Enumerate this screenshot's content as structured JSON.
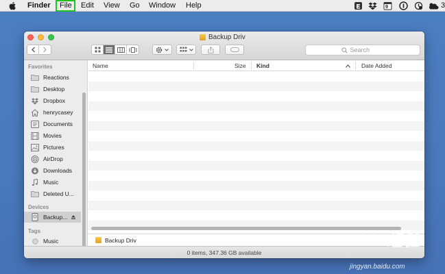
{
  "menubar": {
    "app_name": "Finder",
    "items": [
      "File",
      "Edit",
      "View",
      "Go",
      "Window",
      "Help"
    ],
    "highlighted_item": "File",
    "highlight_color": "#1ec31e",
    "status_icons": [
      "evernote-icon",
      "dropbox-icon",
      "calendar-icon",
      "onepassword-icon",
      "timemachine-icon",
      "weather-icon"
    ],
    "calendar_day": "9",
    "weather_text": "3"
  },
  "window": {
    "title": "Backup Driv",
    "search_placeholder": "Search",
    "view_mode": "list"
  },
  "sidebar": {
    "favorites_header": "Favorites",
    "favorites": [
      {
        "label": "Reactions",
        "icon": "folder-icon"
      },
      {
        "label": "Desktop",
        "icon": "folder-icon"
      },
      {
        "label": "Dropbox",
        "icon": "dropbox-icon"
      },
      {
        "label": "henrycasey",
        "icon": "home-icon"
      },
      {
        "label": "Documents",
        "icon": "documents-icon"
      },
      {
        "label": "Movies",
        "icon": "movies-icon"
      },
      {
        "label": "Pictures",
        "icon": "pictures-icon"
      },
      {
        "label": "AirDrop",
        "icon": "airdrop-icon"
      },
      {
        "label": "Downloads",
        "icon": "downloads-icon"
      },
      {
        "label": "Music",
        "icon": "music-icon"
      },
      {
        "label": "Deleted U...",
        "icon": "folder-icon"
      }
    ],
    "devices_header": "Devices",
    "devices": [
      {
        "label": "Backup...",
        "icon": "drive-icon",
        "selected": true
      }
    ],
    "tags_header": "Tags",
    "tags": [
      {
        "label": "Music",
        "color": "#c9c9c9"
      }
    ]
  },
  "list": {
    "columns": {
      "name": "Name",
      "size": "Size",
      "kind": "Kind",
      "date_added": "Date Added"
    },
    "sorted_column": "Kind"
  },
  "pathbar": {
    "label": "Backup Driv"
  },
  "statusbar": {
    "text": "0 items, 347.36 GB available"
  },
  "watermark": {
    "brand": "Baidu经验",
    "url": "jingyan.baidu.com"
  }
}
